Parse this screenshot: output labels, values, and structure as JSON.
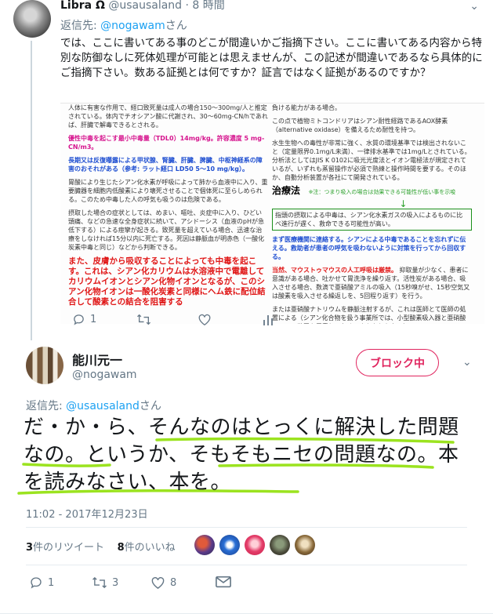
{
  "reply": {
    "display_name": "Libra Ω",
    "handle": "@usausaland",
    "separator": "·",
    "time": "8 時間",
    "replying_to_label": "返信先:",
    "replying_to_handle": "@nogawam",
    "replying_to_suffix": "さん",
    "text": "では、ここに書いてある事のどこが間違いかご指摘下さい。ここに書いてある内容から特別な防御なしに死体処理が可能とは思えませんが、この記述が間違いであるなら具体的にご指摘下さい。数ある証拠とは何ですか？証言ではなく証拠があるのですか？",
    "document": {
      "left": {
        "p1": "人体に有害な作用で、経口致死量は成人の場合150～300mg/人と推定されている。体内でチオシアン酸に代謝され、30～60mg-CN/hであれば、肝臓で解毒できるとされる。",
        "p2": "優性中毒を起こす最小中毒量（TDL0）14mg/kg。許容濃度 5 mg-CN/m3。",
        "p3": "長期又は反復曝露による甲状腺、腎臓、肝臓、脾臓、中枢神経系の障害のおそれがある（参考: ラット経口 LD50 5～10 mg/kg）。",
        "p4": "胃酸により生じたシアン化水素が呼吸によって肺から血液中に入り、重要臓器を細胞内低酸素により壊死させることで個体死に至らしめられる。このため中毒した人の呼気も吸うのは危険である。",
        "p5": "摂取した場合の症状としては、めまい、嘔吐、炎症中に入り、ひどい頭痛、などの急速な全身症状に続いて、アシドーシス（血液のpHが急低下する）による痙攣が起きる。致死量を超えている場合、迅速な治療をしなければ15分以内に死亡する。死因は静脈血が明赤色（一酸化炭素中毒と同じ）などから判断できる。",
        "p6": "また、皮膚から吸収することによっても中毒を起こす。これは、シアン化カリウムは水溶液中で電離してカリウムイオンとシアン化物イオンとなるが、このシアン化物イオンは一酸化炭素と同様にヘム鉄に配位結合して酸素との結合を阻害する"
      },
      "right": {
        "p1": "負ける能力がある場合。",
        "p2": "この点で植物ミトコンドリアはシアン耐性経路であるAOX酵素（alternative oxidase）を備えるため耐性を持つ。",
        "p3": "水生生物への毒性が非常に強く、水質の環境基準では検出されないこと（定量限界0.1mg/L未満）、一律排水基準では1mg/Lとされている。分析法としてはJIS K 0102に吸光光度法とイオン電極法が規定されているが、いずれも蒸留操作が必須で熟練と操作時間を要する。そのほか、自動分析装置が各社にて開発されている。",
        "heading": "治療法",
        "note": "※注：つまり吸入の場合は効果できる可能性が低い事を示唆",
        "arrow": "↓",
        "p4": "指頭の摂取による中毒は、シアン化水素ガスの吸入によるものに比べ進行が遅く、救命できる可能性が高い。",
        "p5": "まず医療機関に連絡する。シアンによる中毒であることを忘れずに伝える。救助者が患者の呼気を吸わないように対策を行ってから回収する。",
        "p6": "当然、マウストゥマウスの人工呼吸は厳禁。",
        "p7": "抑取量が少なく、患者に意識がある場合、吐かせて胃洗浄を繰り返す。活性炭がある場合、吸入させる場合、数滴で亜硝酸アミルの吸入（15秒嗅がせ、15秒空気又は酸素を吸入させる繰返しを、5回程り返す）を行う。",
        "p8": "または亜硝酸ナトリウムを静脈注射するが、これは医師とて医師の処置による（シアン化合物を扱う事業所では、小型酸素吸入器と亜硝酸アミルの装置を用意しておくべきかもしれない）。"
      }
    },
    "actions": {
      "reply_count": "1",
      "retweet_count": "",
      "like_count": ""
    }
  },
  "main": {
    "display_name": "能川元一",
    "handle": "@nogawam",
    "block_button": "ブロック中",
    "replying_to_label": "返信先:",
    "replying_to_handle": "@usausaland",
    "replying_to_suffix": "さん",
    "text": "だ・か・ら、そんなのはとっくに解決した問題なの。というか、そもそもニセの問題なの。本を読みなさい、本を。",
    "timestamp": "11:02 - 2017年12月23日",
    "retweets_num": "3",
    "retweets_label": "件のリツイート",
    "likes_num": "8",
    "likes_label": "件のいいね",
    "actions": {
      "reply_count": "1",
      "retweet_count": "3",
      "like_count": "8"
    }
  },
  "icons": [
    "reply-icon",
    "retweet-icon",
    "like-icon",
    "stats-icon",
    "mail-icon",
    "chevron-down-icon"
  ],
  "colors": {
    "accent": "#1da1f2",
    "block": "#e0245e",
    "muted": "#657786",
    "highlight": "#9be31f"
  }
}
